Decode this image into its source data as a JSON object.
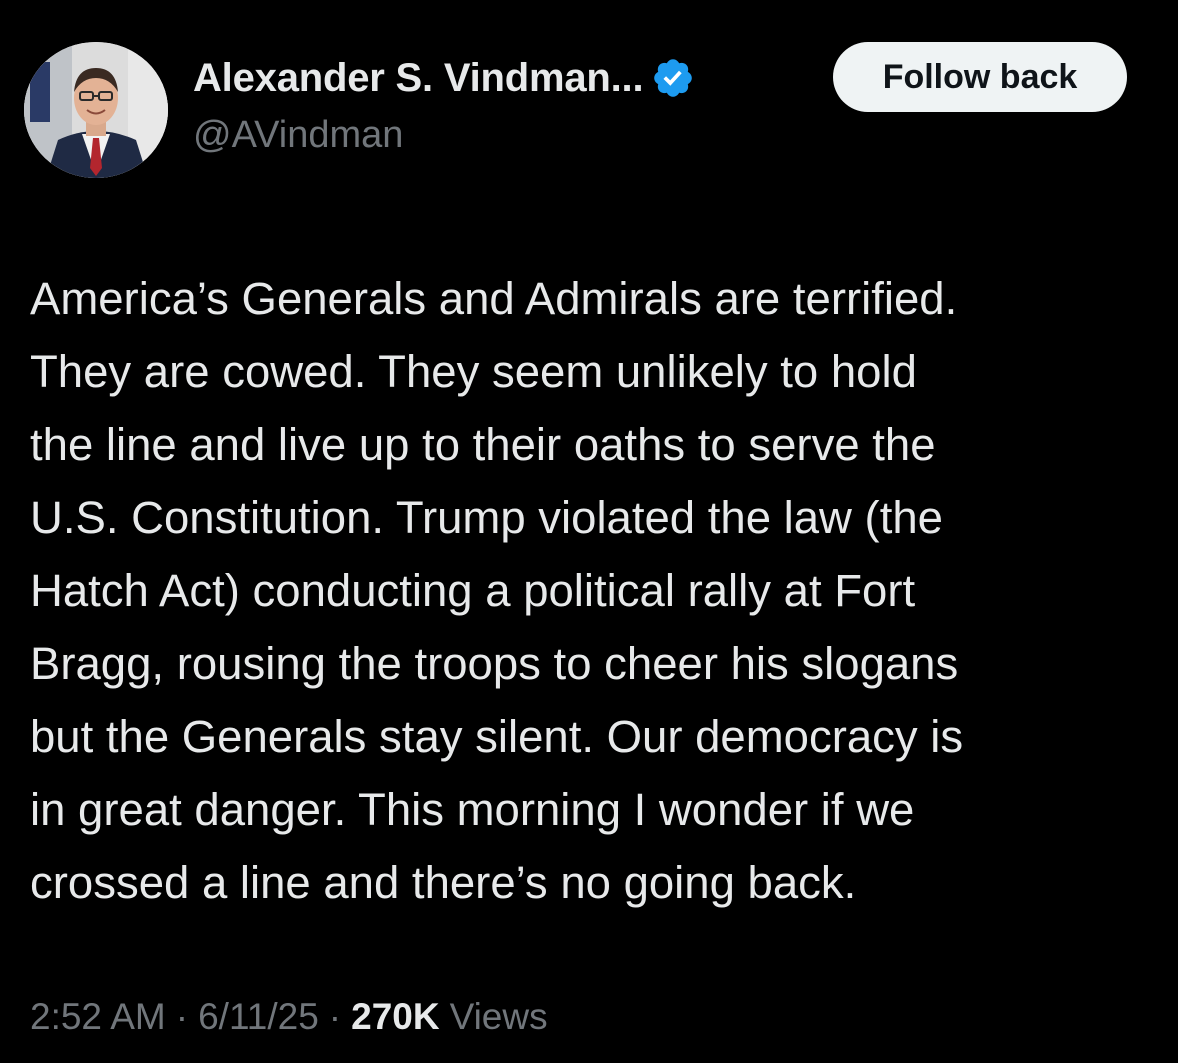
{
  "author": {
    "display_name": "Alexander S. Vindman...",
    "handle": "@AVindman",
    "verified_badge_color": "#1d9bf0"
  },
  "actions": {
    "follow_label": "Follow back"
  },
  "tweet": {
    "lines": [
      "America’s Generals and Admirals are terrified.",
      "They are cowed. They seem unlikely to hold",
      "the line and live up to their oaths to serve the",
      "U.S. Constitution. Trump violated the law (the",
      "Hatch Act) conducting a political rally at Fort",
      "Bragg, rousing the troops to cheer his slogans",
      "but the Generals stay silent. Our democracy is",
      "in great danger. This morning I wonder if we",
      "crossed a line and there’s no going back."
    ]
  },
  "meta": {
    "time": "2:52 AM",
    "separator": "·",
    "date": "6/11/25",
    "views_count": "270K",
    "views_label": "Views"
  },
  "colors": {
    "background": "#000000",
    "primary_text": "#e7e9ea",
    "secondary_text": "#71767b",
    "button_bg": "#eff3f4",
    "button_text": "#0f1419"
  },
  "icons": {
    "verified": "verified-badge-icon"
  }
}
